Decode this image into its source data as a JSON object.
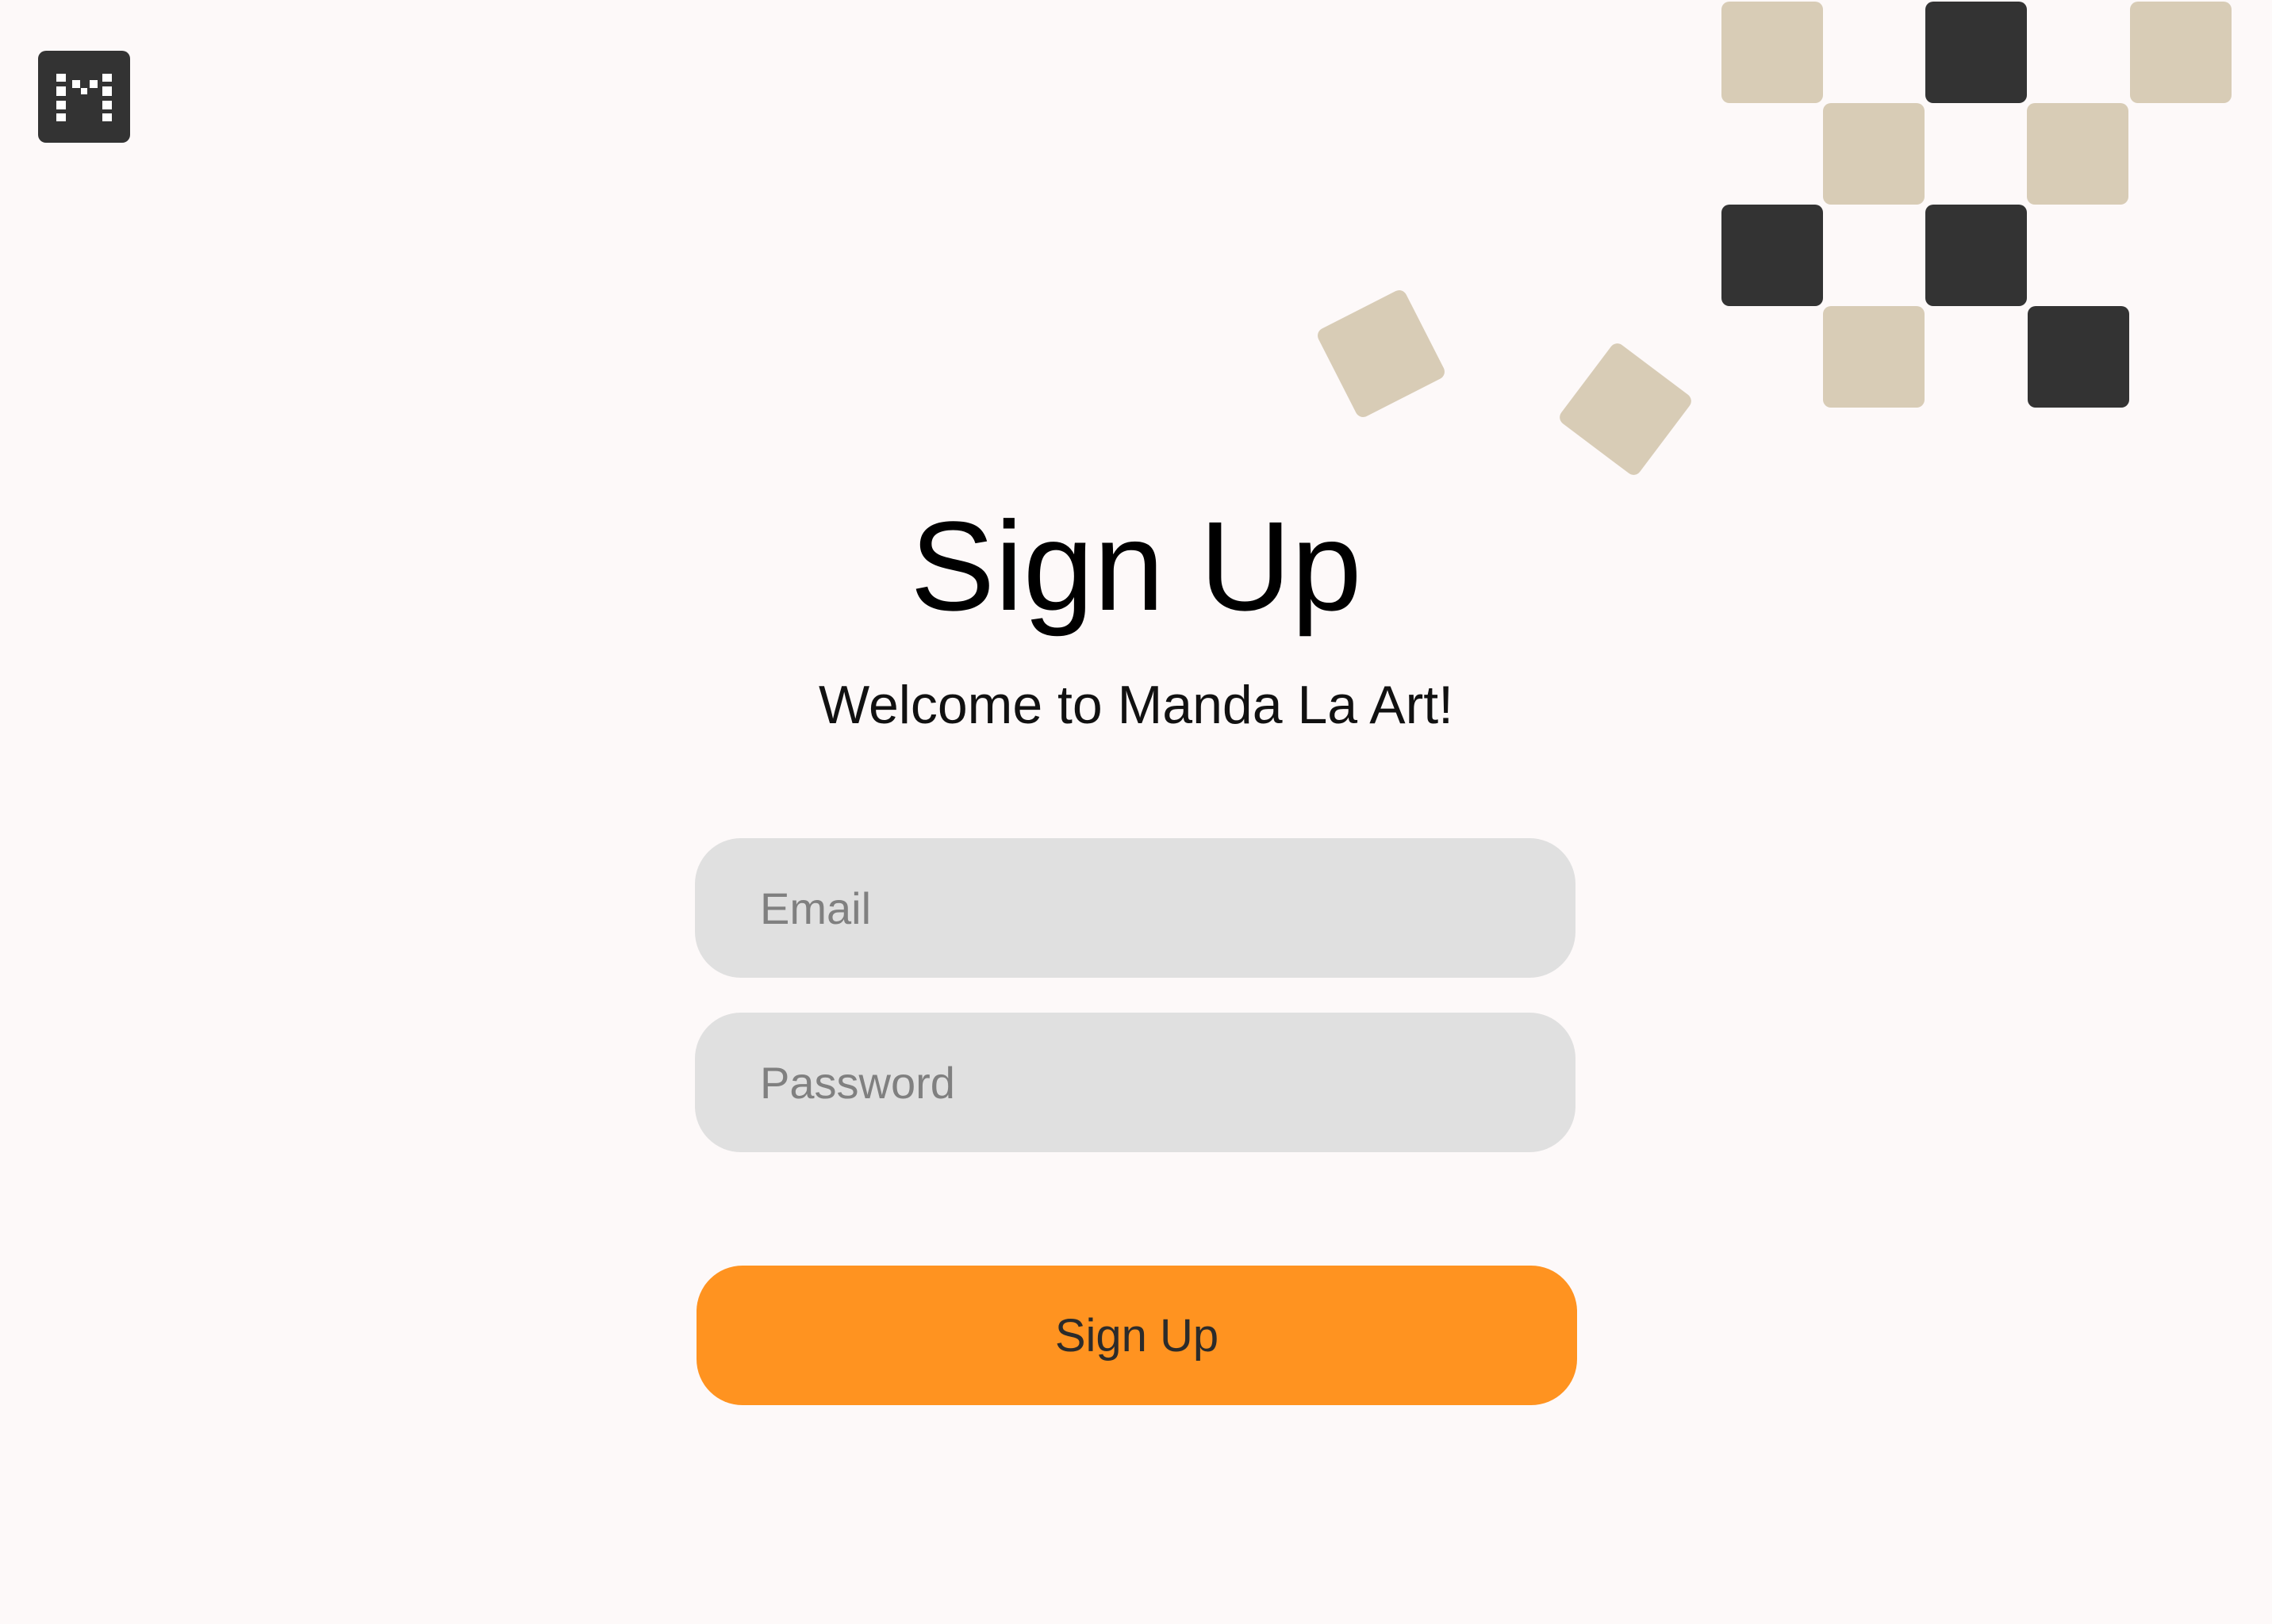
{
  "app": {
    "logo_icon": "pixel-m-logo-icon",
    "logo_background": "#333333"
  },
  "signup": {
    "title": "Sign Up",
    "subtitle": "Welcome to Manda La Art!",
    "email_placeholder": "Email",
    "password_placeholder": "Password",
    "submit_label": "Sign Up"
  },
  "decoration": {
    "pattern_icon": "checkerboard-tiles-pattern",
    "colors": {
      "beige": "#D8CCB6",
      "dark": "#333333"
    }
  },
  "theme": {
    "background": "#FDF9F9",
    "input_background": "#E0E0E0",
    "placeholder_color": "#808080",
    "accent": "#FF9320"
  }
}
